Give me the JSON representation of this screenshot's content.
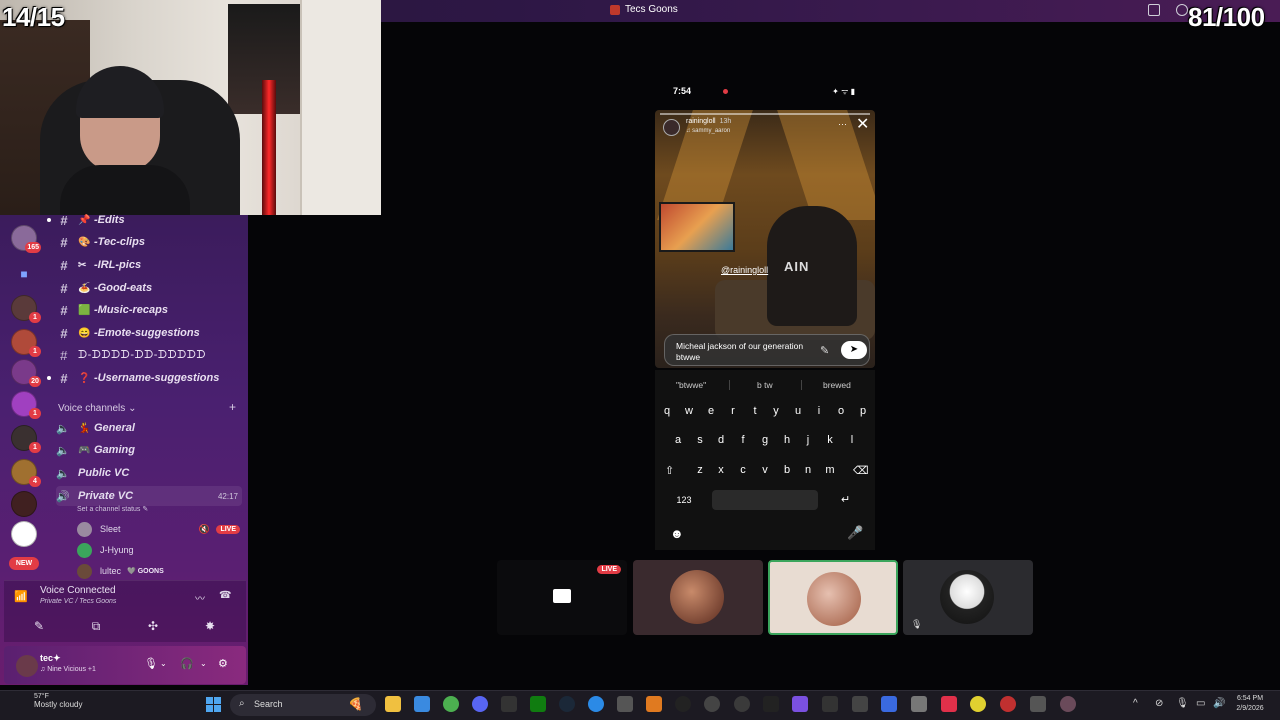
{
  "window": {
    "title": "Tecs Goons"
  },
  "overlay": {
    "left_counter": "14/15",
    "right_counter": "81/100"
  },
  "sidebar": {
    "guild_badges": [
      "165",
      "1",
      "1",
      "20",
      "1",
      "1",
      "4",
      "NEW"
    ],
    "channels": [
      {
        "emoji": "📌",
        "name": "-Edits"
      },
      {
        "emoji": "🎨",
        "name": "-Tec-clips"
      },
      {
        "emoji": "✂",
        "name": "-IRL-pics"
      },
      {
        "emoji": "🍝",
        "name": "-Good-eats"
      },
      {
        "emoji": "🟩",
        "name": "-Music-recaps"
      },
      {
        "emoji": "😄",
        "name": "-Emote-suggestions"
      },
      {
        "emoji": "",
        "name": "ᗪ-ᗪᗪᗪᗪ-ᗪᗪ-ᗪᗪᗪᗪᗪ"
      },
      {
        "emoji": "❓",
        "name": "-Username-suggestions"
      }
    ],
    "voice_header": "Voice channels",
    "voice_channels": [
      {
        "emoji": "💃",
        "name": "General"
      },
      {
        "emoji": "🎮",
        "name": "Gaming"
      },
      {
        "emoji": "",
        "name": "Public VC"
      },
      {
        "emoji": "",
        "name": "Private VC",
        "time": "42:17"
      }
    ],
    "channel_status": "Set a channel status",
    "voice_users": [
      {
        "name": "Sleet",
        "live": "LIVE"
      },
      {
        "name": "J-Hyung"
      },
      {
        "name": "lultec",
        "tag": "GOONS"
      }
    ],
    "voice_panel": {
      "title": "Voice Connected",
      "subtitle": "Private VC / Tecs Goons"
    },
    "user": {
      "name": "tec",
      "activity": "Nine Vicious +1"
    }
  },
  "phone": {
    "time": "7:54",
    "story_user": "rainingloll",
    "story_age": "13h",
    "story_music": "sammy_aaron",
    "mention": "@rainingloll",
    "shirt_text": "AIN",
    "reply_text": "Micheal jackson of our generation btwwe",
    "suggestions": [
      "\"btwwe\"",
      "b tw",
      "brewed"
    ],
    "keys_row1": [
      "q",
      "w",
      "e",
      "r",
      "t",
      "y",
      "u",
      "i",
      "o",
      "p"
    ],
    "keys_row2": [
      "a",
      "s",
      "d",
      "f",
      "g",
      "h",
      "j",
      "k",
      "l"
    ],
    "keys_row3": [
      "z",
      "x",
      "c",
      "v",
      "b",
      "n",
      "m"
    ],
    "numbers_key": "123"
  },
  "tiles": {
    "live_label": "LIVE"
  },
  "taskbar": {
    "weather_temp": "57°F",
    "weather_desc": "Mostly cloudy",
    "search_label": "Search",
    "time": "6:54 PM",
    "date": "2/9/2026"
  }
}
